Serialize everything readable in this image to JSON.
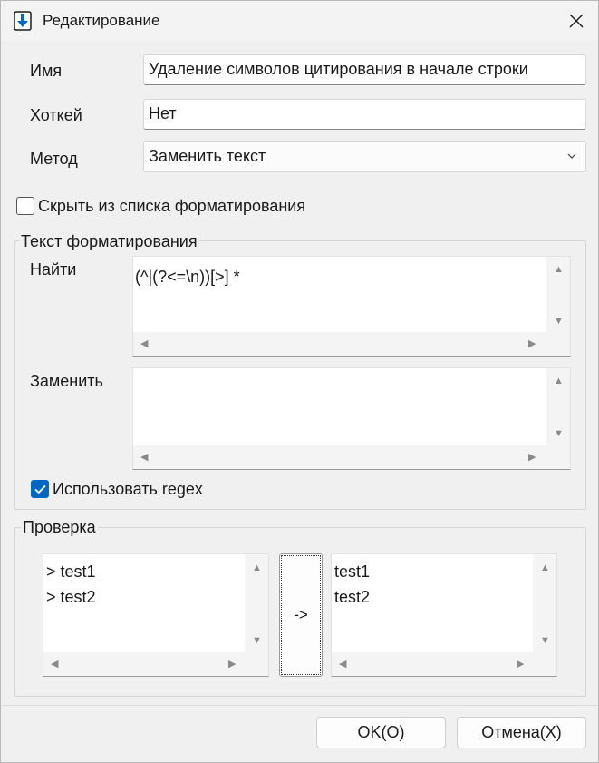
{
  "window": {
    "title": "Редактирование"
  },
  "form": {
    "name_label": "Имя",
    "name_value": "Удаление символов цитирования в начале строки",
    "hotkey_label": "Хоткей",
    "hotkey_value": "Нет",
    "method_label": "Метод",
    "method_value": "Заменить текст",
    "hide_label": "Скрыть из списка форматирования",
    "hide_checked": false
  },
  "format_group": {
    "title": "Текст форматирования",
    "find_label": "Найти",
    "find_value": "(^|(?<=\\n))[>] *",
    "replace_label": "Заменить",
    "replace_value": "",
    "regex_label": "Использовать regex",
    "regex_checked": true
  },
  "check_group": {
    "title": "Проверка",
    "input_text": "> test1\n> test2",
    "arrow_label": "->",
    "output_text": "test1\ntest2"
  },
  "buttons": {
    "ok_prefix": "OK(",
    "ok_key": "O",
    "ok_suffix": ")",
    "cancel_prefix": "Отмена(",
    "cancel_key": "X",
    "cancel_suffix": ")"
  },
  "colors": {
    "accent": "#0067c0"
  }
}
